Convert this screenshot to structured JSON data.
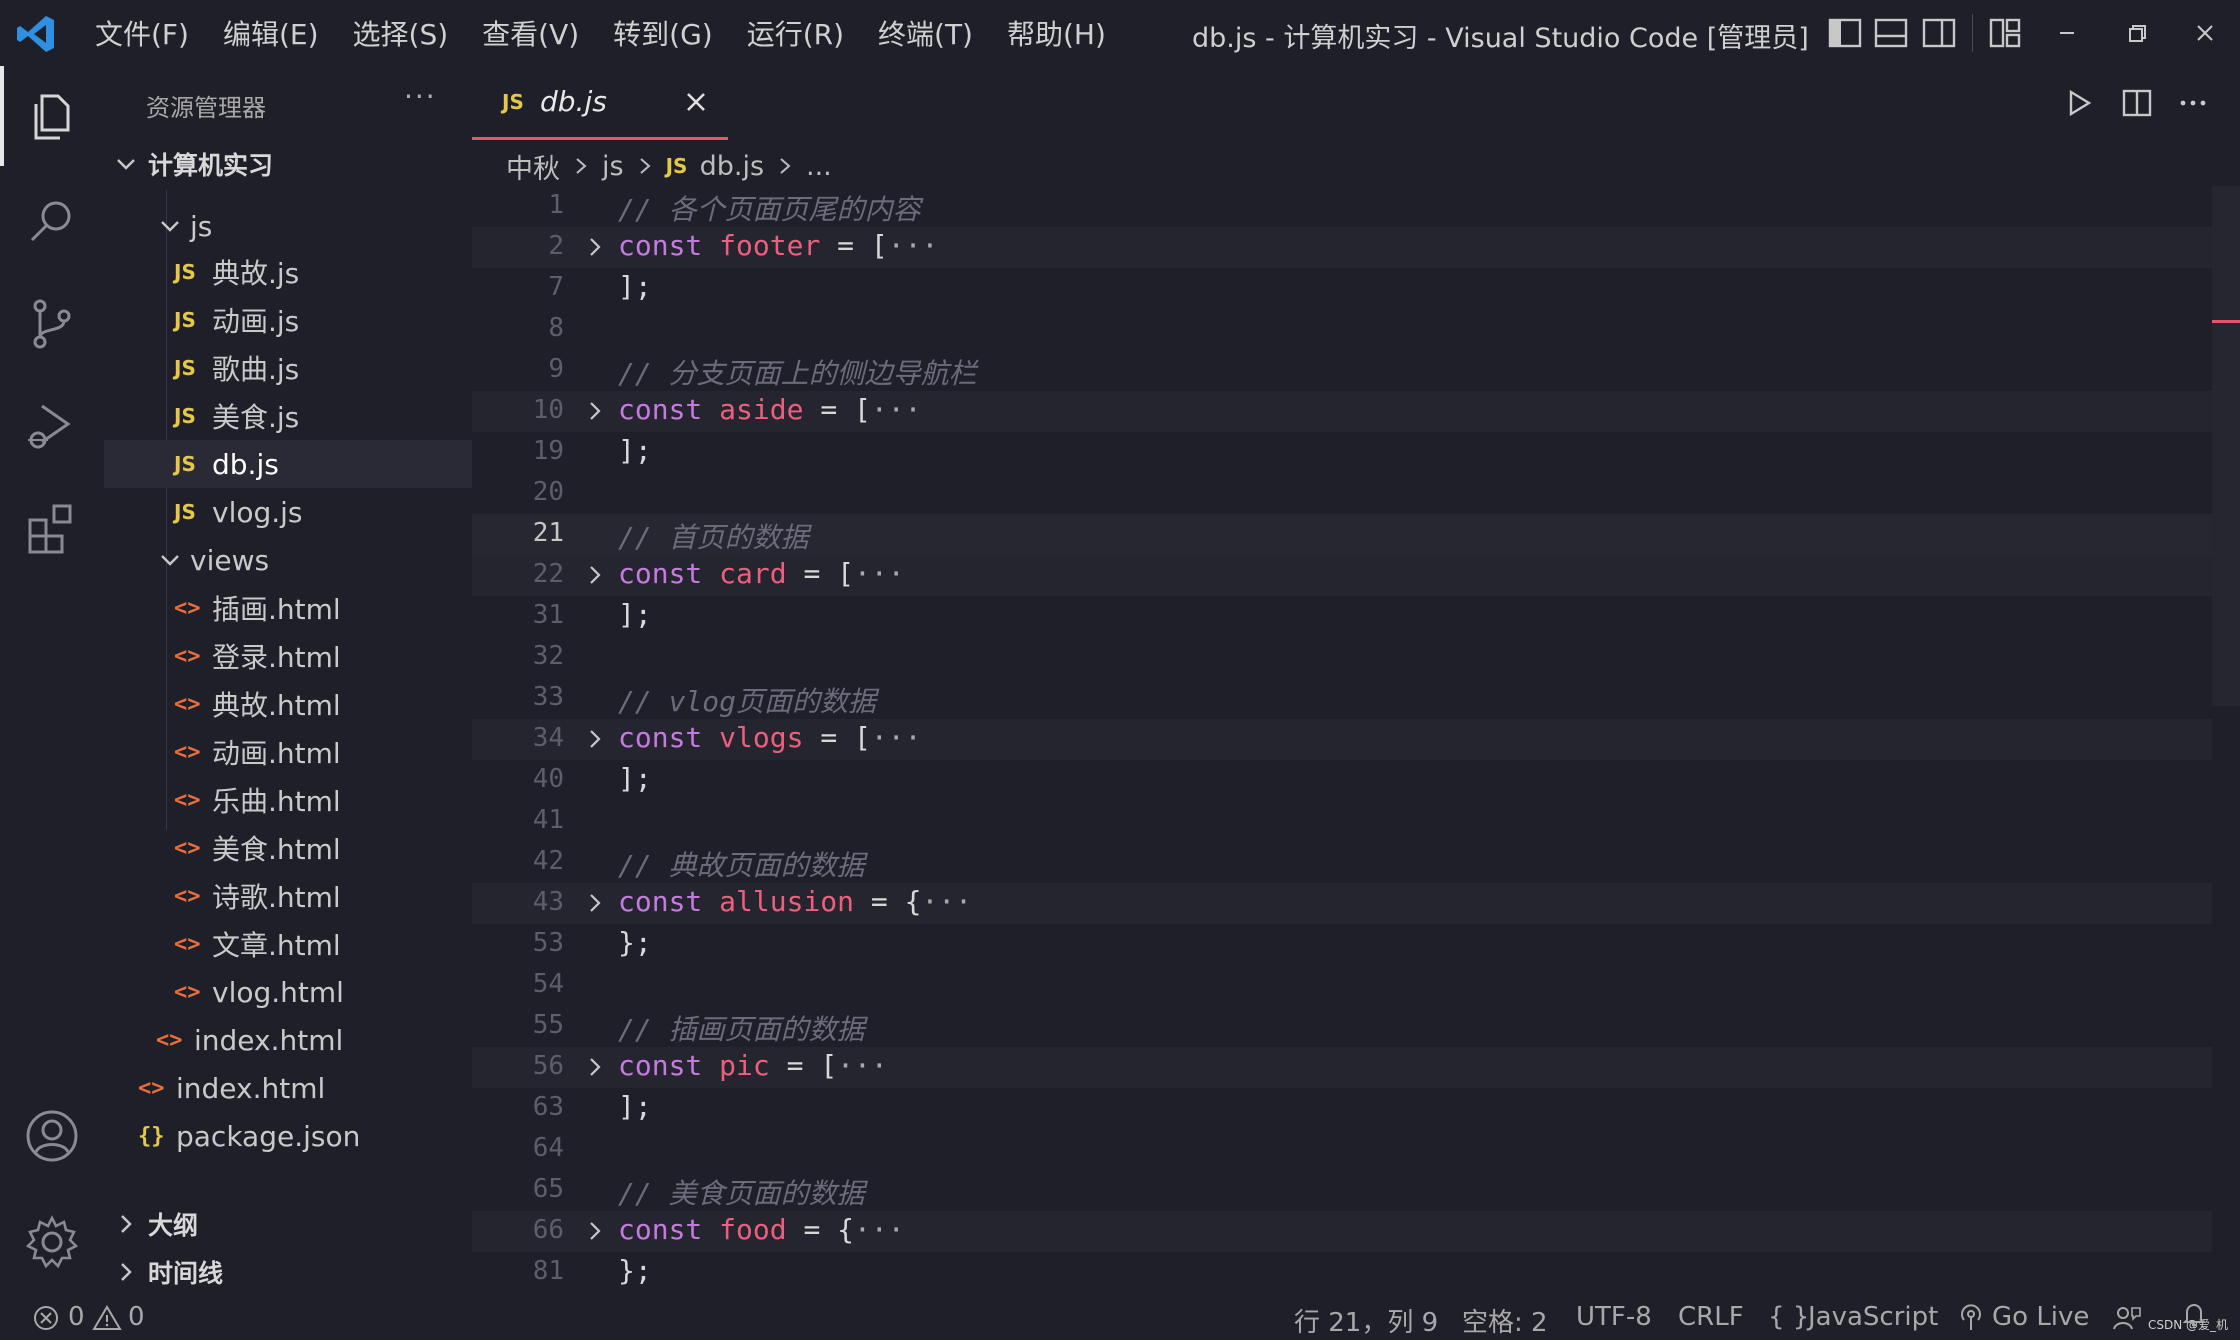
{
  "window": {
    "title": "db.js - 计算机实习 - Visual Studio Code [管理员]",
    "menu": [
      "文件(F)",
      "编辑(E)",
      "选择(S)",
      "查看(V)",
      "转到(G)",
      "运行(R)",
      "终端(T)",
      "帮助(H)"
    ]
  },
  "sidebar": {
    "title": "资源管理器",
    "more": "···",
    "root": "计算机实习",
    "folders": {
      "js": "js",
      "views": "views"
    },
    "js_files": [
      "典故.js",
      "动画.js",
      "歌曲.js",
      "美食.js",
      "db.js",
      "vlog.js"
    ],
    "view_files": [
      "插画.html",
      "登录.html",
      "典故.html",
      "动画.html",
      "乐曲.html",
      "美食.html",
      "诗歌.html",
      "文章.html",
      "vlog.html"
    ],
    "src_index": "index.html",
    "root_index": "index.html",
    "package": "package.json",
    "outline": "大纲",
    "timeline": "时间线",
    "badges": {
      "js": "JS",
      "html": "<>",
      "json": "{}"
    }
  },
  "editor": {
    "tab": {
      "badge": "JS",
      "label": "db.js"
    },
    "breadcrumb": [
      "中秋",
      "js",
      "db.js",
      "..."
    ],
    "lines": [
      {
        "n": "1",
        "type": "comment",
        "text": "// 各个页面页尾的内容"
      },
      {
        "n": "2",
        "type": "decl",
        "kw": "const",
        "name": "footer",
        "open": "["
      },
      {
        "n": "7",
        "type": "close",
        "text": "];"
      },
      {
        "n": "8",
        "type": "blank"
      },
      {
        "n": "9",
        "type": "comment",
        "text": "// 分支页面上的侧边导航栏"
      },
      {
        "n": "10",
        "type": "decl",
        "kw": "const",
        "name": "aside",
        "open": "["
      },
      {
        "n": "19",
        "type": "close",
        "text": "];"
      },
      {
        "n": "20",
        "type": "blank"
      },
      {
        "n": "21",
        "type": "comment",
        "text": "// 首页的数据",
        "current": true
      },
      {
        "n": "22",
        "type": "decl",
        "kw": "const",
        "name": "card",
        "open": "["
      },
      {
        "n": "31",
        "type": "close",
        "text": "];"
      },
      {
        "n": "32",
        "type": "blank"
      },
      {
        "n": "33",
        "type": "comment",
        "text": "// vlog页面的数据"
      },
      {
        "n": "34",
        "type": "decl",
        "kw": "const",
        "name": "vlogs",
        "open": "["
      },
      {
        "n": "40",
        "type": "close",
        "text": "];"
      },
      {
        "n": "41",
        "type": "blank"
      },
      {
        "n": "42",
        "type": "comment",
        "text": "// 典故页面的数据"
      },
      {
        "n": "43",
        "type": "decl",
        "kw": "const",
        "name": "allusion",
        "open": "{"
      },
      {
        "n": "53",
        "type": "close",
        "text": "};"
      },
      {
        "n": "54",
        "type": "blank"
      },
      {
        "n": "55",
        "type": "comment",
        "text": "// 插画页面的数据"
      },
      {
        "n": "56",
        "type": "decl",
        "kw": "const",
        "name": "pic",
        "open": "["
      },
      {
        "n": "63",
        "type": "close",
        "text": "];"
      },
      {
        "n": "64",
        "type": "blank"
      },
      {
        "n": "65",
        "type": "comment",
        "text": "// 美食页面的数据"
      },
      {
        "n": "66",
        "type": "decl",
        "kw": "const",
        "name": "food",
        "open": "{"
      },
      {
        "n": "81",
        "type": "close",
        "text": "};"
      }
    ],
    "equals": "=",
    "ellipsis": "···"
  },
  "statusbar": {
    "errors": "0",
    "warnings": "0",
    "position": "行 21，列 9",
    "spaces": "空格: 2",
    "encoding": "UTF-8",
    "eol": "CRLF",
    "language_icon": "{ }",
    "language": "JavaScript",
    "golive": "Go Live",
    "watermark": "CSDN @爱_机"
  },
  "colors": {
    "accent": "#e2576d",
    "keyword": "#c57ae0",
    "variable": "#ec5f7d",
    "comment": "#6b6b7b",
    "js_badge": "#e3c84a",
    "html_badge": "#e66f3b",
    "vscode_logo": "#2f8fe0"
  },
  "icons": {
    "activity": [
      "explorer-icon",
      "search-icon",
      "source-control-icon",
      "run-debug-icon",
      "extensions-icon",
      "account-icon",
      "settings-gear-icon"
    ],
    "titlebar": [
      "toggle-primary-sidebar-icon",
      "toggle-panel-icon",
      "toggle-secondary-sidebar-icon",
      "customize-layout-icon",
      "minimize-icon",
      "restore-icon",
      "close-icon"
    ],
    "editor_actions": [
      "run-icon",
      "split-editor-icon",
      "more-actions-icon"
    ]
  }
}
